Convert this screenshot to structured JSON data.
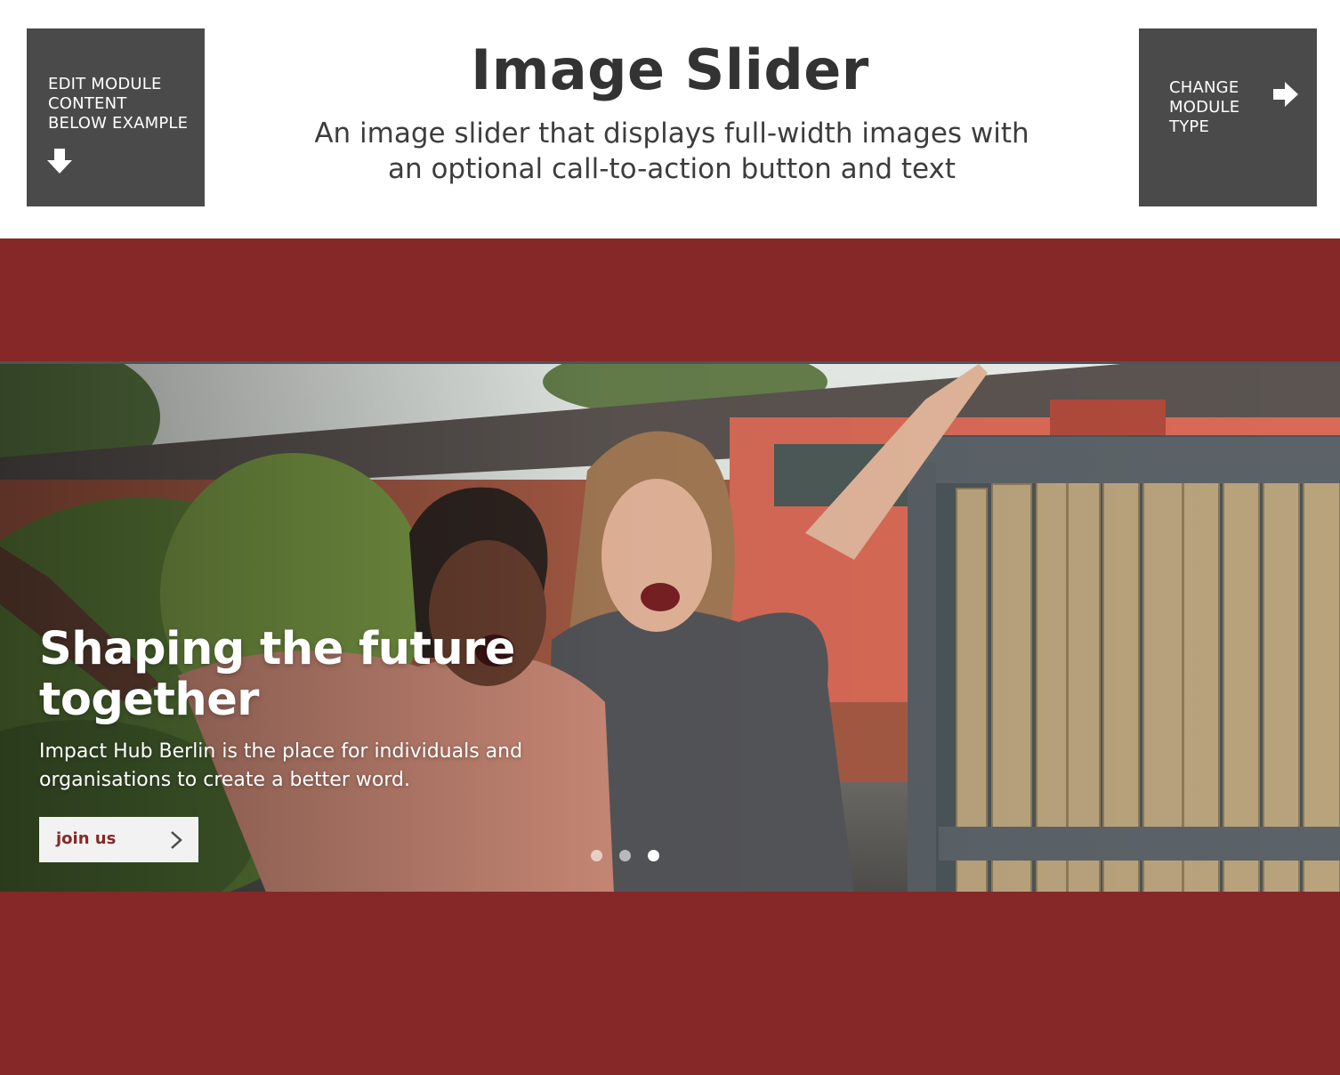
{
  "header": {
    "title": "Image Slider",
    "subtitle": "An image slider that displays full-width images with an optional call-to-action button and text",
    "edit_button": {
      "label": "EDIT MODULE\nCONTENT\nBELOW EXAMPLE",
      "icon": "arrow-down-icon"
    },
    "change_button": {
      "label": "CHANGE\nMODULE\nTYPE",
      "icon": "arrow-right-icon"
    }
  },
  "slider": {
    "background_color": "#862828",
    "slide": {
      "heading": "Shaping the future together",
      "text": "Impact Hub Berlin is the place for individuals and organisations to create a better word.",
      "cta_label": "join us",
      "cta_icon": "chevron-right-icon"
    },
    "pagination": {
      "count": 3,
      "active_index": 2
    }
  },
  "colors": {
    "brand": "#862828",
    "button_dark": "#4a4a4a",
    "cta_background": "#f2f2f2"
  }
}
